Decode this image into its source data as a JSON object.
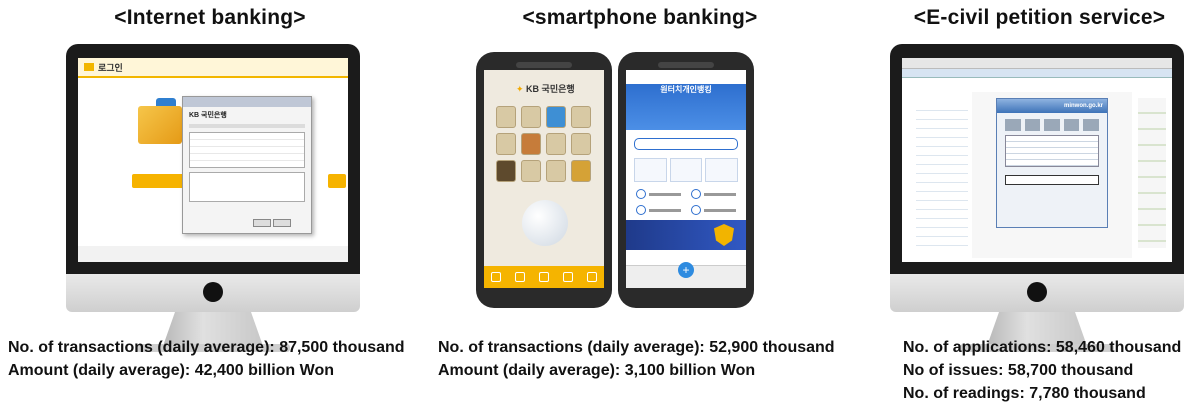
{
  "panels": [
    {
      "title": "<Internet banking>",
      "lines": [
        {
          "label": "No. of transactions (daily average):",
          "value": "87,500 thousand"
        },
        {
          "label": "Amount (daily average):",
          "value": "42,400 billion Won"
        }
      ]
    },
    {
      "title": "<smartphone banking>",
      "lines": [
        {
          "label": "No. of transactions (daily average):",
          "value": "52,900 thousand"
        },
        {
          "label": "Amount (daily average):",
          "value": "3,100 billion Won"
        }
      ]
    },
    {
      "title": "<E-civil petition service>",
      "lines": [
        {
          "label": "No. of applications:",
          "value": "58,460 thousand"
        },
        {
          "label": "No of issues:",
          "value": "58,700 thousand"
        },
        {
          "label": "No. of readings:",
          "value": "7,780 thousand"
        }
      ]
    }
  ],
  "screens": {
    "internet_banking_logo": "로그인",
    "internet_banking_dialog_brand": "KB 국민은행",
    "phone1_brand": "KB 국민은행",
    "phone2_title": "원터치개인뱅킹",
    "ecivil_site": "minwon.go.kr"
  },
  "colors": {
    "kb_yellow": "#f5b400",
    "woori_blue": "#2e6fcf",
    "monitor_bezel": "#1b1b1b"
  }
}
